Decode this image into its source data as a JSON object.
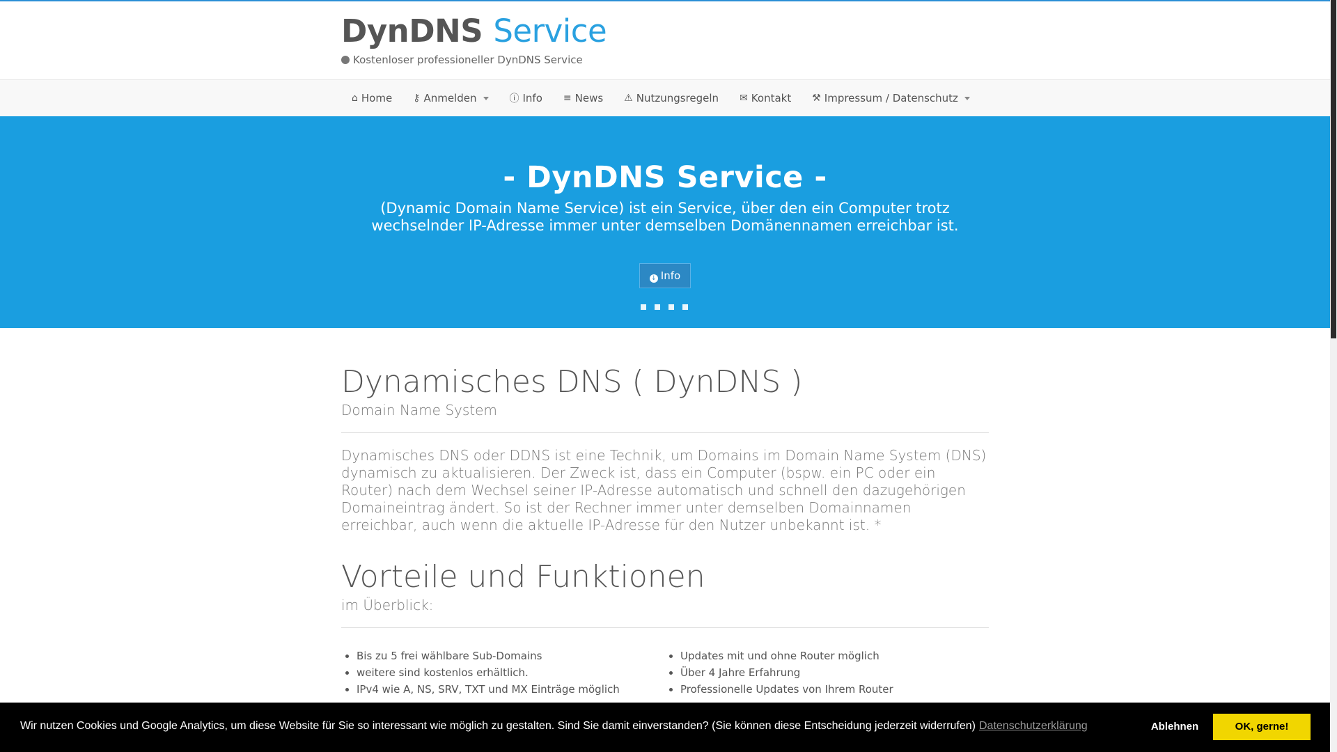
{
  "header": {
    "brand_main": "DynDNS",
    "brand_accent": "Service",
    "tagline": "Kostenloser professioneller DynDNS Service",
    "tagline_icon": "globe-icon"
  },
  "nav": {
    "items": [
      {
        "label": "Home",
        "icon": "home-icon",
        "glyph": "⌂"
      },
      {
        "label": "Anmelden",
        "icon": "key-icon",
        "glyph": "⚷",
        "dropdown": true
      },
      {
        "label": "Info",
        "icon": "info-circle-icon",
        "glyph": "ⓘ"
      },
      {
        "label": "News",
        "icon": "list-icon",
        "glyph": "≡"
      },
      {
        "label": "Nutzungsregeln",
        "icon": "warning-icon",
        "glyph": "⚠"
      },
      {
        "label": "Kontakt",
        "icon": "envelope-icon",
        "glyph": "✉"
      },
      {
        "label": "Impressum / Datenschutz",
        "icon": "wrench-icon",
        "glyph": "⚒",
        "dropdown": true
      }
    ]
  },
  "hero": {
    "title": "- DynDNS Service -",
    "text": "(Dynamic Domain Name Service) ist ein Service, über den ein Computer trotz wechselnder IP-Adresse immer unter demselben Domänennamen erreichbar ist.",
    "button_label": "Info",
    "button_icon": "arrow-circle-down-icon",
    "slide_count": 4
  },
  "section1": {
    "title": "Dynamisches DNS ( DynDNS )",
    "subtitle": "Domain Name System",
    "lead": "Dynamisches DNS oder DDNS ist eine Technik, um Domains im Domain Name System (DNS) dynamisch zu aktualisieren. Der Zweck ist, dass ein Computer (bspw. ein PC oder ein Router) nach dem Wechsel seiner IP-Adresse automatisch und schnell den dazugehörigen Domaineintrag ändert. So ist der Rechner immer unter demselben Domainnamen erreichbar, auch wenn die aktuelle IP-Adresse für den Nutzer unbekannt ist. *"
  },
  "section2": {
    "title": "Vorteile und Funktionen",
    "subtitle": "im Überblick:",
    "left_items": [
      "Bis zu 5 frei wählbare Sub-Domains",
      "weitere sind kostenlos erhältlich.",
      "IPv4 wie A, NS, SRV, TXT und MX Einträge möglich"
    ],
    "right_items": [
      "Updates mit und ohne Router möglich",
      "Über 4 Jahre Erfahrung",
      "Professionelle Updates von Ihrem Router"
    ]
  },
  "cookie": {
    "message": "Wir nutzen Cookies und Google Analytics, um diese Website für Sie so interessant wie möglich zu gestalten. Sind Sie damit einverstanden? (Sie können diese Entscheidung jederzeit widerrufen)",
    "link": "Datenschutzerklärung",
    "decline": "Ablehnen",
    "accept": "OK, gerne!"
  },
  "colors": {
    "accent": "#2aa1e0",
    "hero_bg": "#1a9ee0",
    "cookie_bg": "#000000",
    "accept_bg": "#f1d600"
  }
}
